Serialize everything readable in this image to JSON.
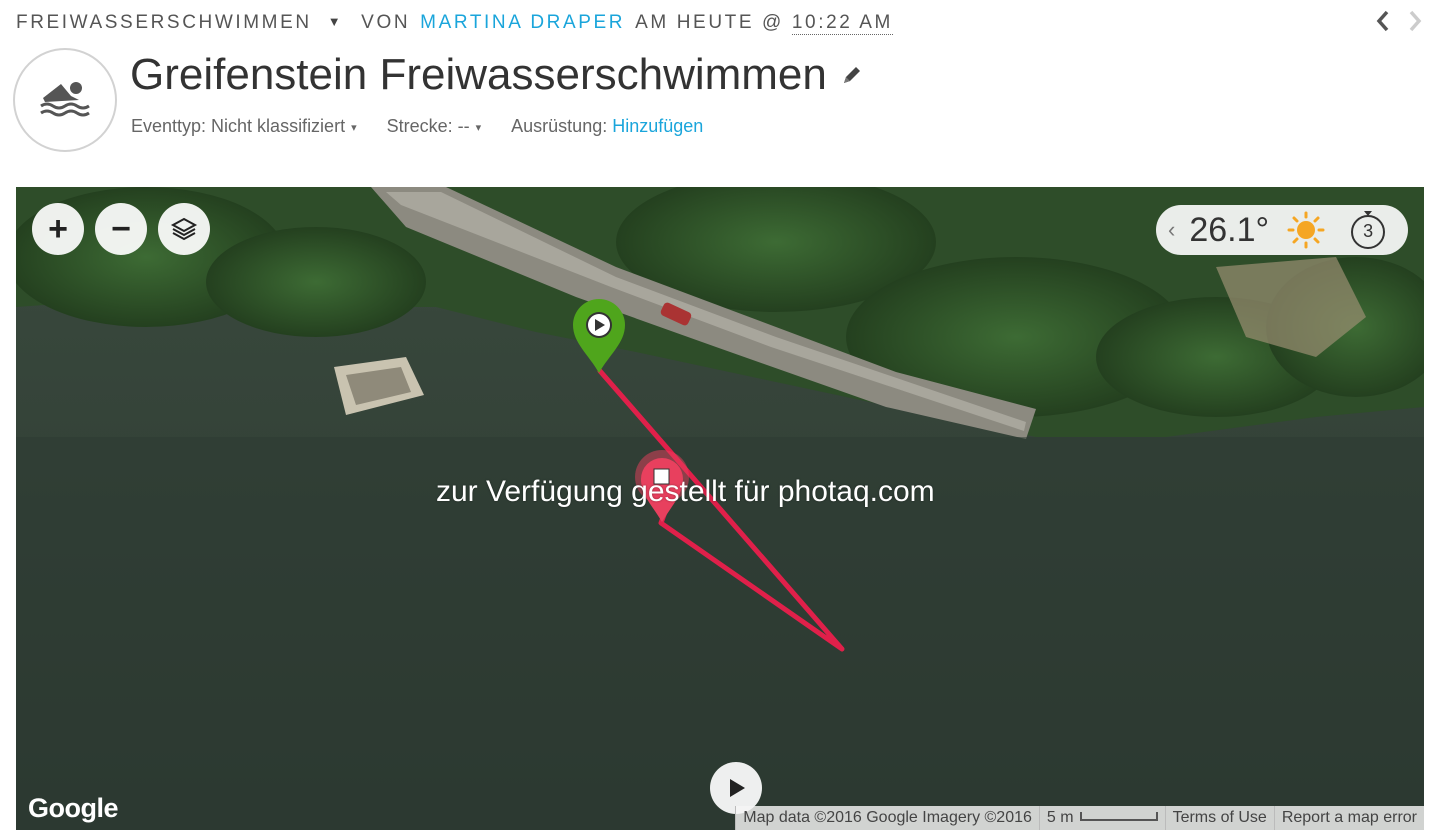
{
  "header": {
    "activity_type": "FREIWASSERSCHWIMMEN",
    "caret": "▼",
    "by_label": "VON",
    "author": "MARTINA DRAPER",
    "when_label": "AM HEUTE @",
    "time": "10:22 AM",
    "prev_icon": "chevron-left-icon",
    "next_icon": "chevron-right-icon"
  },
  "activity": {
    "icon": "swim-icon",
    "title": "Greifenstein Freiwasserschwimmen",
    "edit_icon": "pencil-icon",
    "event_type_label": "Eventtyp: Nicht klassifiziert",
    "course_label": "Strecke: --",
    "dropdown_glyph": "▾",
    "gear_label": "Ausrüstung:",
    "gear_link": "Hinzufügen"
  },
  "map": {
    "zoom_in": "+",
    "zoom_out": "−",
    "layers_icon": "layers-icon",
    "watermark": "zur Verfügung gestellt für photaq.com",
    "google_logo": "Google",
    "map_data": "Map data ©2016 Google Imagery ©2016",
    "scale_text": "5 m",
    "terms": "Terms of Use",
    "report": "Report a map error",
    "play_icon": "play-icon",
    "start_marker_icon": "start-pin-icon",
    "end_marker_icon": "end-pin-icon",
    "track_color": "#e0204a",
    "start_color": "#4fa51c",
    "end_color": "#e8405e"
  },
  "weather": {
    "prev": "‹",
    "temperature": "26.1°",
    "condition_icon": "sun-icon",
    "timer_value": "3",
    "sun_color": "#f5a623"
  }
}
